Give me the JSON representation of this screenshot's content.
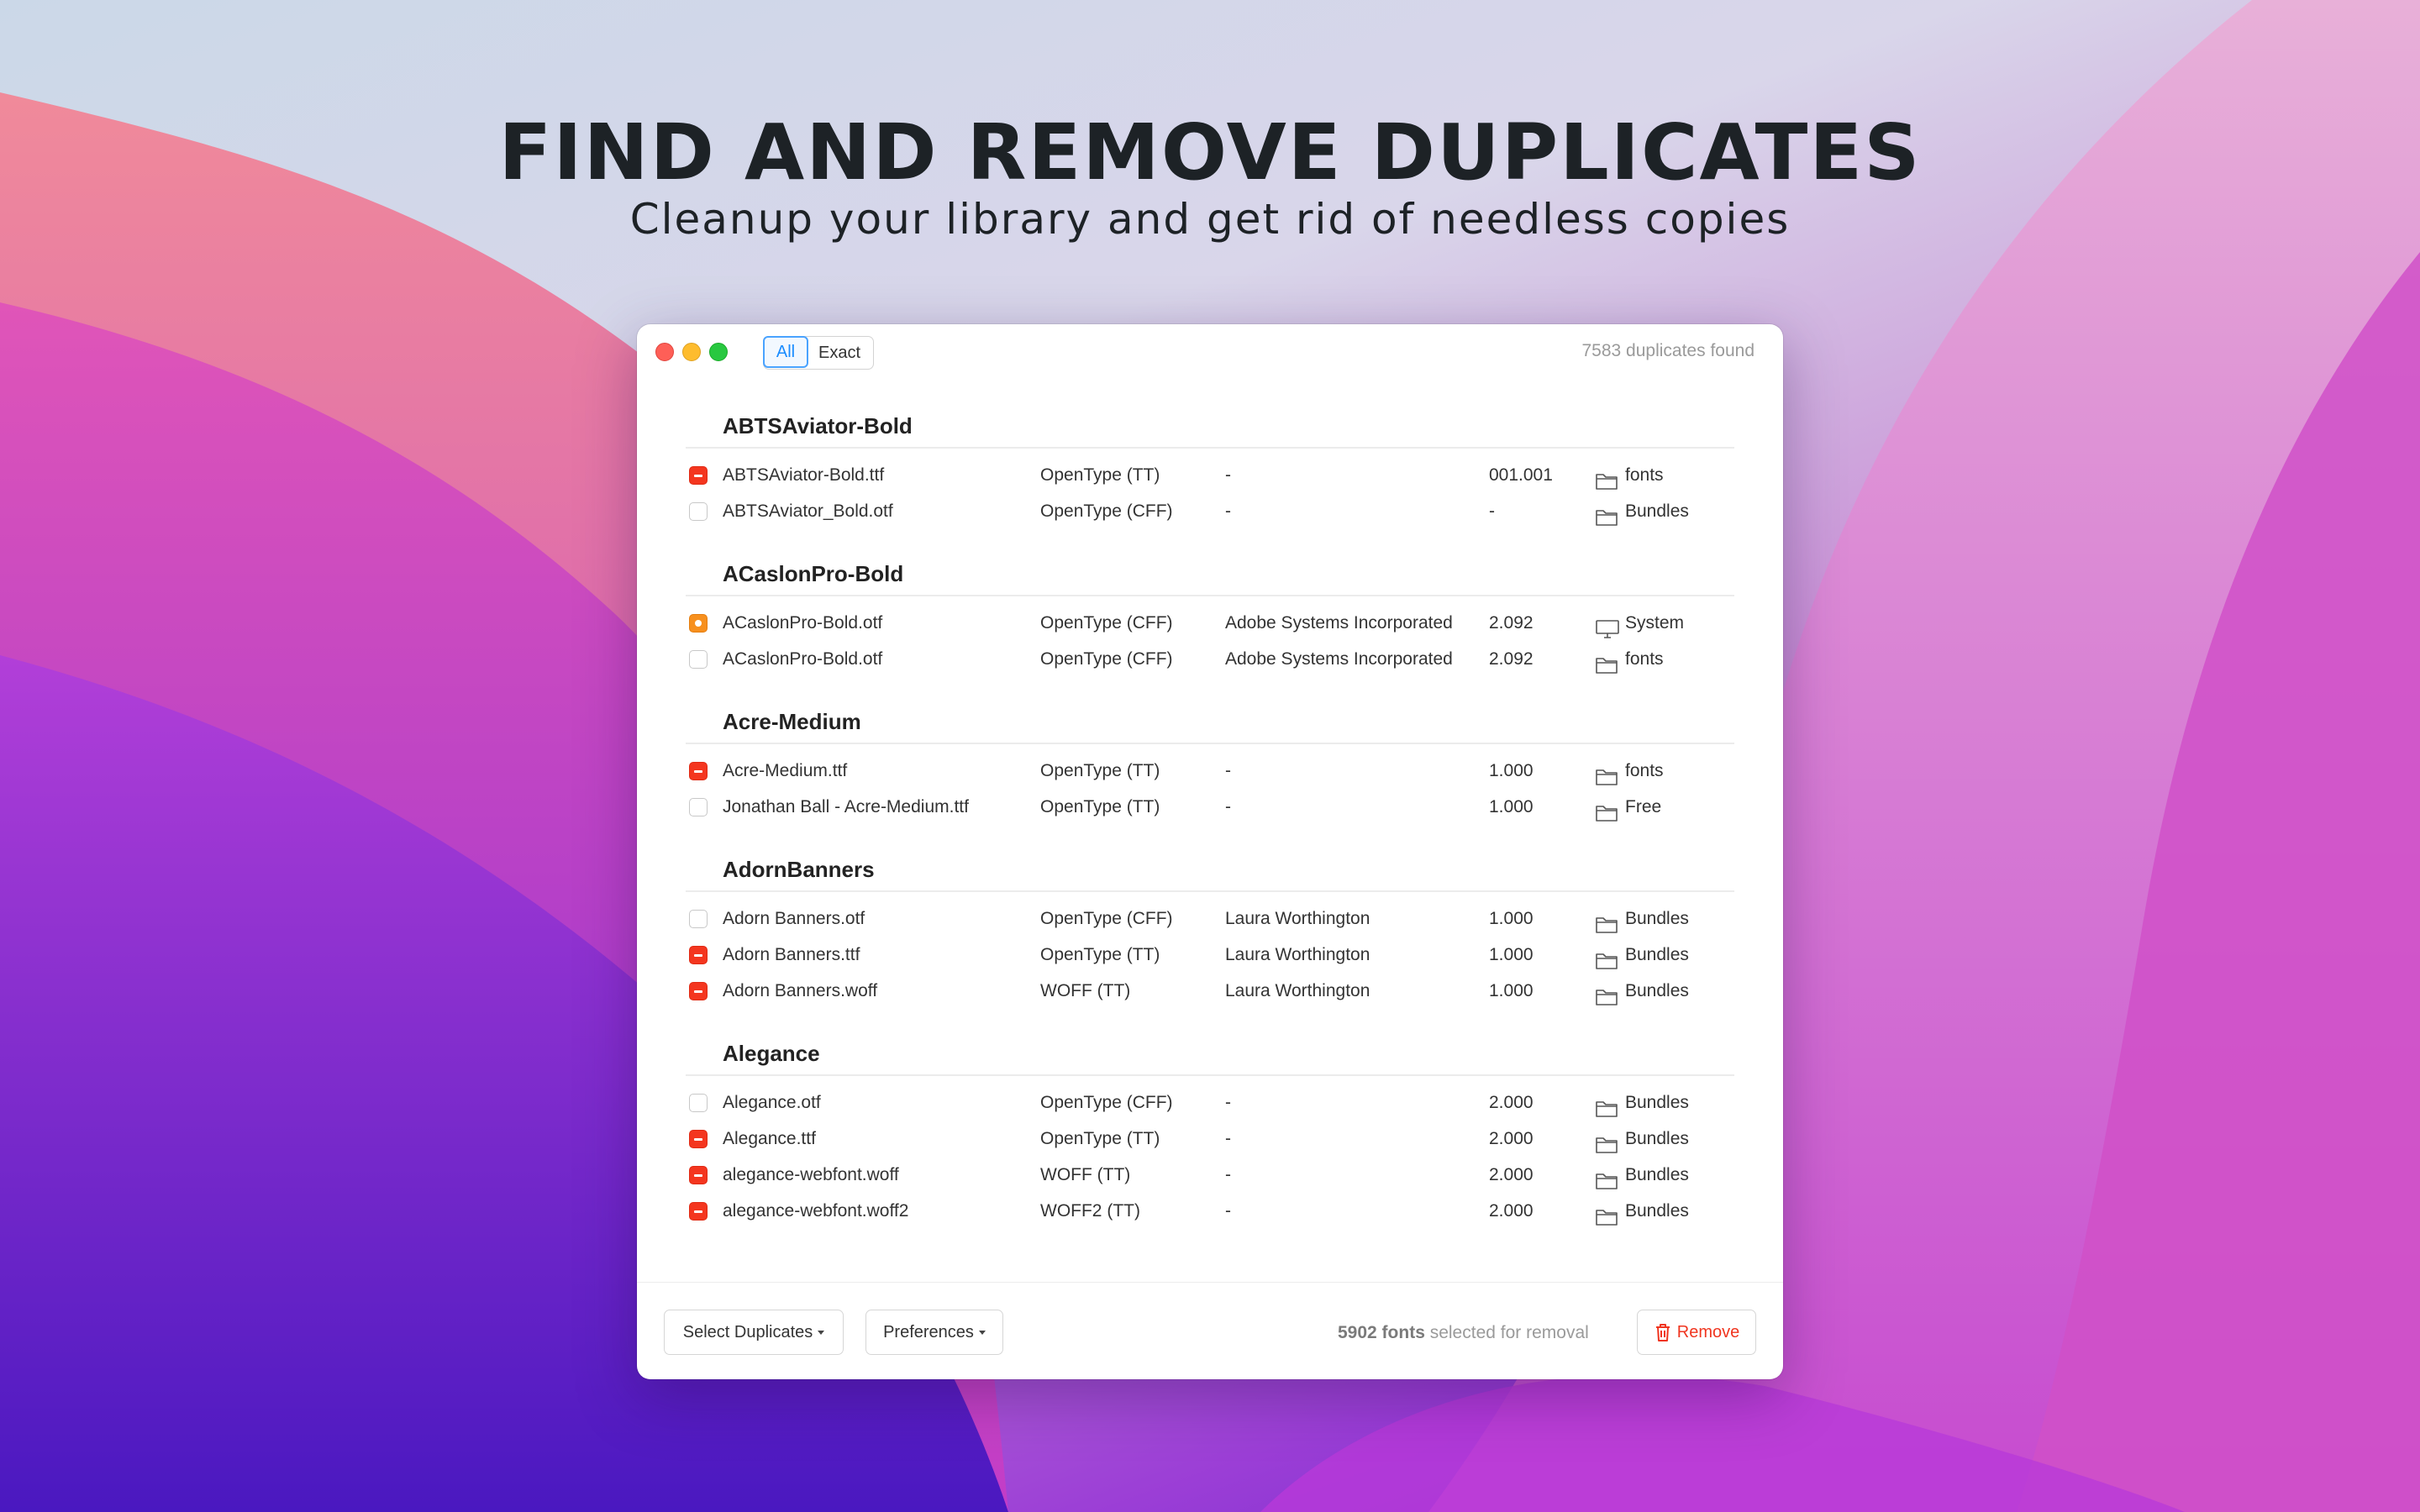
{
  "headline": "FIND AND REMOVE DUPLICATES",
  "subline": "Cleanup your library and get rid of needless copies",
  "window": {
    "filter": {
      "all_label": "All",
      "exact_label": "Exact",
      "selected": "All"
    },
    "found_text": "7583 duplicates found",
    "groups": [
      {
        "title": "ABTSAviator-Bold",
        "rows": [
          {
            "state": "minus",
            "name": "ABTSAviator-Bold.ttf",
            "type": "OpenType (TT)",
            "maker": "-",
            "version": "001.001",
            "location": "fonts",
            "loc_icon": "folder-icon"
          },
          {
            "state": "off",
            "name": "ABTSAviator_Bold.otf",
            "type": "OpenType (CFF)",
            "maker": "-",
            "version": "-",
            "location": "Bundles",
            "loc_icon": "folder-icon"
          }
        ]
      },
      {
        "title": "ACaslonPro-Bold",
        "rows": [
          {
            "state": "dot",
            "name": "ACaslonPro-Bold.otf",
            "type": "OpenType (CFF)",
            "maker": "Adobe Systems Incorporated",
            "version": "2.092",
            "location": "System",
            "loc_icon": "monitor-icon"
          },
          {
            "state": "off",
            "name": "ACaslonPro-Bold.otf",
            "type": "OpenType (CFF)",
            "maker": "Adobe Systems Incorporated",
            "version": "2.092",
            "location": "fonts",
            "loc_icon": "folder-icon"
          }
        ]
      },
      {
        "title": "Acre-Medium",
        "rows": [
          {
            "state": "minus",
            "name": "Acre-Medium.ttf",
            "type": "OpenType (TT)",
            "maker": "-",
            "version": "1.000",
            "location": "fonts",
            "loc_icon": "folder-icon"
          },
          {
            "state": "off",
            "name": "Jonathan Ball - Acre-Medium.ttf",
            "type": "OpenType (TT)",
            "maker": "-",
            "version": "1.000",
            "location": "Free",
            "loc_icon": "folder-icon"
          }
        ]
      },
      {
        "title": "AdornBanners",
        "rows": [
          {
            "state": "off",
            "name": "Adorn Banners.otf",
            "type": "OpenType (CFF)",
            "maker": "Laura Worthington",
            "version": "1.000",
            "location": "Bundles",
            "loc_icon": "folder-icon"
          },
          {
            "state": "minus",
            "name": "Adorn Banners.ttf",
            "type": "OpenType (TT)",
            "maker": "Laura Worthington",
            "version": "1.000",
            "location": "Bundles",
            "loc_icon": "folder-icon"
          },
          {
            "state": "minus",
            "name": "Adorn Banners.woff",
            "type": "WOFF (TT)",
            "maker": "Laura Worthington",
            "version": "1.000",
            "location": "Bundles",
            "loc_icon": "folder-icon"
          }
        ]
      },
      {
        "title": "Alegance",
        "rows": [
          {
            "state": "off",
            "name": "Alegance.otf",
            "type": "OpenType (CFF)",
            "maker": "-",
            "version": "2.000",
            "location": "Bundles",
            "loc_icon": "folder-icon"
          },
          {
            "state": "minus",
            "name": "Alegance.ttf",
            "type": "OpenType (TT)",
            "maker": "-",
            "version": "2.000",
            "location": "Bundles",
            "loc_icon": "folder-icon"
          },
          {
            "state": "minus",
            "name": "alegance-webfont.woff",
            "type": "WOFF (TT)",
            "maker": "-",
            "version": "2.000",
            "location": "Bundles",
            "loc_icon": "folder-icon"
          },
          {
            "state": "minus",
            "name": "alegance-webfont.woff2",
            "type": "WOFF2 (TT)",
            "maker": "-",
            "version": "2.000",
            "location": "Bundles",
            "loc_icon": "folder-icon"
          }
        ]
      }
    ],
    "footer": {
      "select_label": "Select Duplicates",
      "prefs_label": "Preferences",
      "count_bold": "5902 fonts",
      "count_rest": " selected for removal",
      "remove_label": "Remove"
    }
  },
  "colors": {
    "minus_checkbox": "#f4361f",
    "dot_checkbox": "#f7901e",
    "accent_blue": "#1a8cff",
    "remove_red": "#f0351f"
  }
}
